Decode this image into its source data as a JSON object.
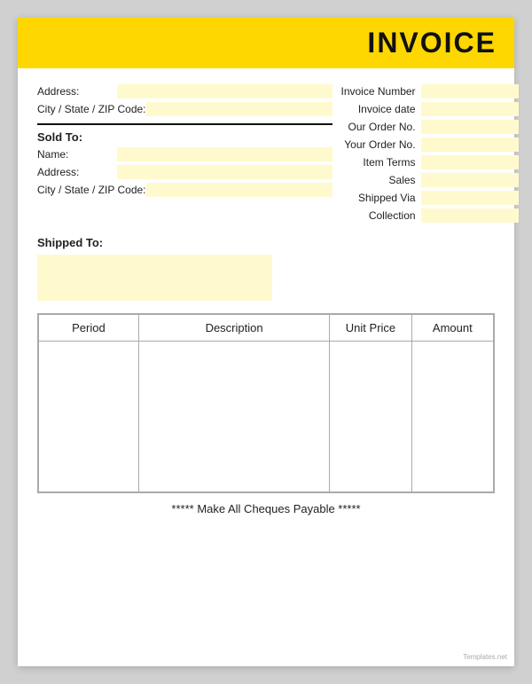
{
  "header": {
    "title": "INVOICE",
    "bg_color": "#FFD700"
  },
  "left": {
    "address_label": "Address:",
    "city_label": "City / State / ZIP Code:",
    "sold_to_label": "Sold To:",
    "name_label": "Name:",
    "address2_label": "Address:",
    "city2_label": "City / State / ZIP Code:"
  },
  "right": {
    "invoice_number_label": "Invoice Number",
    "invoice_date_label": "Invoice date",
    "our_order_label": "Our Order No.",
    "your_order_label": "Your Order No.",
    "item_terms_label": "Item Terms",
    "sales_label": "Sales",
    "shipped_via_label": "Shipped Via",
    "collection_label": "Collection"
  },
  "shipped_to": {
    "label": "Shipped To:"
  },
  "table": {
    "col_period": "Period",
    "col_description": "Description",
    "col_unit_price": "Unit Price",
    "col_amount": "Amount"
  },
  "footer": {
    "text": "***** Make All Cheques Payable *****"
  },
  "watermark": "Templates.net"
}
